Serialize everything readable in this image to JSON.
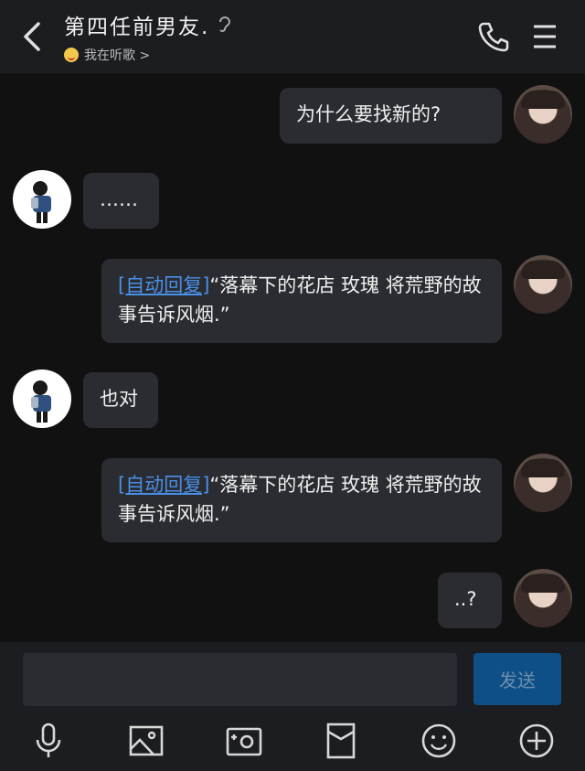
{
  "header": {
    "title": "第四任前男友.",
    "subtitle": "我在听歌 >",
    "icons": [
      "back-arrow-icon",
      "ear-icon",
      "phone-icon",
      "menu-icon"
    ]
  },
  "messages": [
    {
      "from": "me",
      "text": "为什么要找新的?"
    },
    {
      "from": "other",
      "text": "……"
    },
    {
      "from": "me",
      "tag": "[自动回复]",
      "text": "“落幕下的花店 玫瑰 将荒野的故事告诉风烟.”"
    },
    {
      "from": "other",
      "text": "也对"
    },
    {
      "from": "me",
      "tag": "[自动回复]",
      "text": "“落幕下的花店 玫瑰 将荒野的故事告诉风烟.”"
    },
    {
      "from": "me",
      "text": "..?"
    }
  ],
  "input": {
    "value": "",
    "placeholder": "",
    "send_label": "发送"
  },
  "toolbar": {
    "icons": [
      "microphone-icon",
      "image-icon",
      "camera-icon",
      "red-packet-icon",
      "emoji-icon",
      "plus-icon"
    ]
  },
  "colors": {
    "background": "#111111",
    "bar": "#1c1d20",
    "bubble": "#2a2c31",
    "link": "#4a8fe7",
    "send": "#0d4f86"
  }
}
